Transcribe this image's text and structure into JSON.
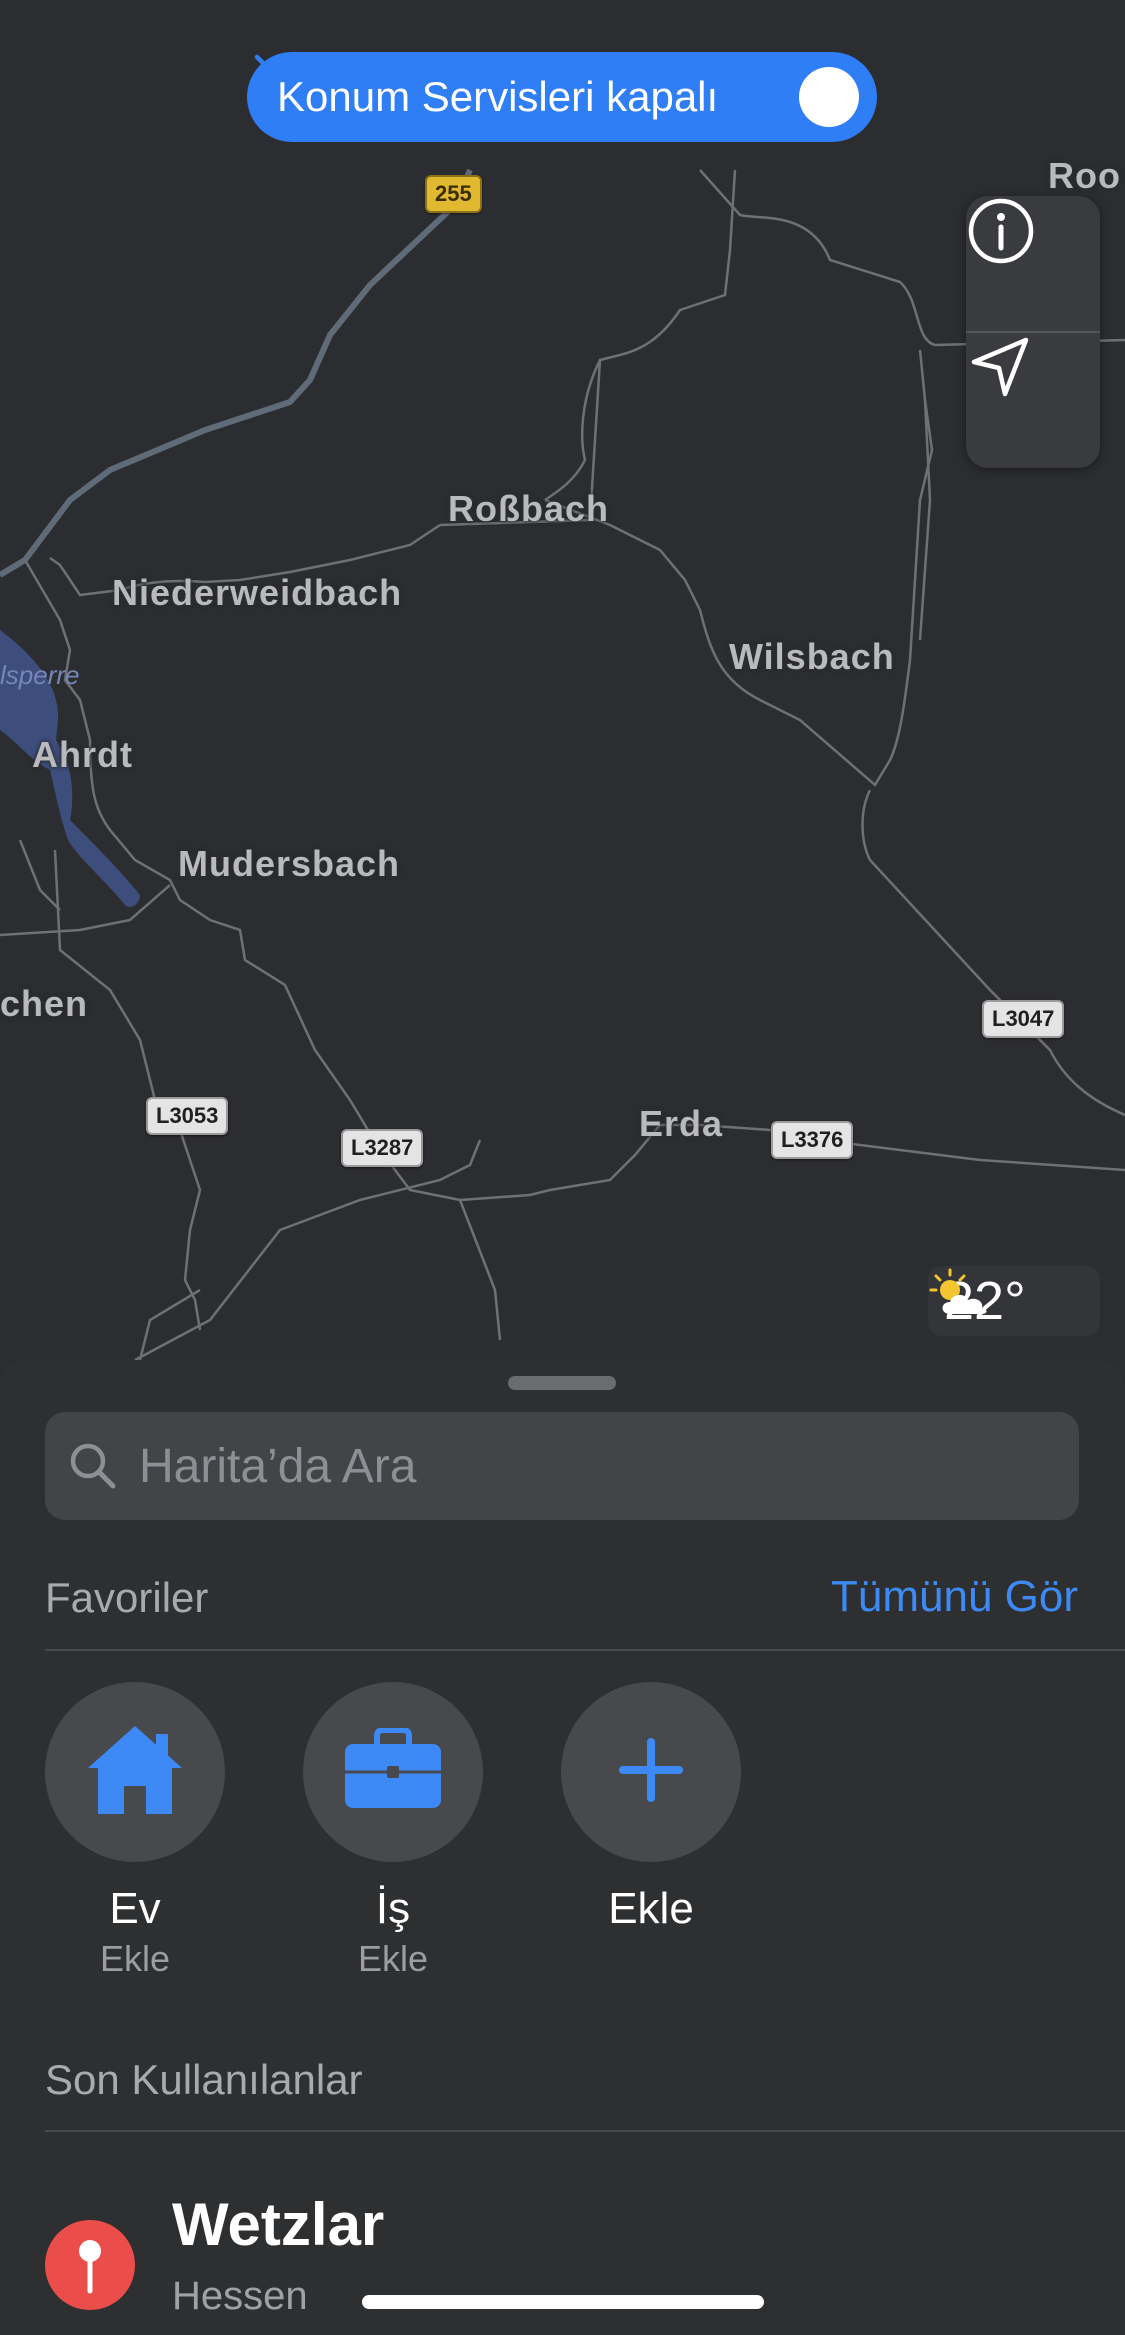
{
  "banner": {
    "label": "Konum Servisleri kapalı",
    "icon": "chevron-right-icon"
  },
  "map": {
    "towns": [
      "Roßbach",
      "Niederweidbach",
      "Wilsbach",
      "Ahrdt",
      "Mudersbach",
      "chen",
      "Erda",
      "Roo"
    ],
    "water": [
      "lsperre"
    ],
    "roads": [
      "255",
      "L3047",
      "L3053",
      "L3287",
      "L3376"
    ]
  },
  "controls": {
    "info_icon": "info-icon",
    "location_icon": "location-arrow-icon"
  },
  "weather": {
    "icon": "partly-sunny-icon",
    "temperature": "22°"
  },
  "search": {
    "placeholder": "Harita’da Ara",
    "icon": "search-icon"
  },
  "favorites": {
    "title": "Favoriler",
    "see_all": "Tümünü Gör",
    "items": [
      {
        "title": "Ev",
        "subtitle": "Ekle",
        "icon": "home-icon"
      },
      {
        "title": "İş",
        "subtitle": "Ekle",
        "icon": "briefcase-icon"
      },
      {
        "title": "Ekle",
        "subtitle": "",
        "icon": "plus-icon"
      }
    ]
  },
  "recents": {
    "title": "Son Kullanılanlar",
    "items": [
      {
        "title": "Wetzlar",
        "subtitle": "Hessen",
        "icon": "pin-icon"
      }
    ]
  },
  "colors": {
    "accent": "#2f7ef5",
    "pin": "#eb4d4a",
    "map_bg": "#2c2d30",
    "sheet_bg": "#2e2f31"
  }
}
